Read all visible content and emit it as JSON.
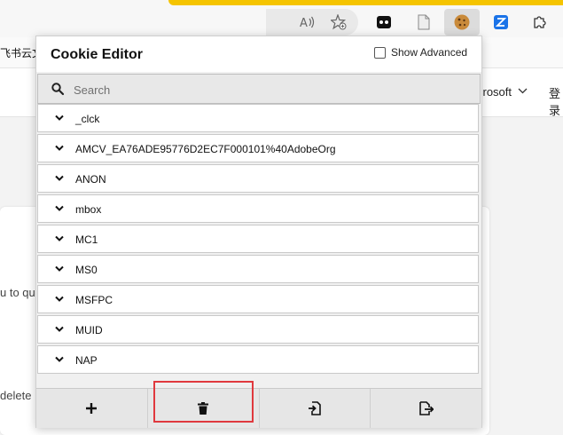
{
  "browser": {
    "favorites_text": "飞书云文",
    "nav_microsoft": "crosoft",
    "nav_login": "登录",
    "icons": [
      "read-aloud-icon",
      "add-favorite-icon",
      "extension-video-icon",
      "document-icon",
      "cookie-extension-icon",
      "extension-z-icon",
      "extensions-puzzle-icon"
    ]
  },
  "background_page": {
    "text_line_1": "u to qu",
    "text_line_2": "delete"
  },
  "popup": {
    "title": "Cookie Editor",
    "show_advanced_label": "Show Advanced",
    "show_advanced_checked": false,
    "search": {
      "placeholder": "Search",
      "value": ""
    },
    "cookies": [
      {
        "name": "_clck"
      },
      {
        "name": "AMCV_EA76ADE95776D2EC7F000101%40AdobeOrg"
      },
      {
        "name": "ANON"
      },
      {
        "name": "mbox"
      },
      {
        "name": "MC1"
      },
      {
        "name": "MS0"
      },
      {
        "name": "MSFPC"
      },
      {
        "name": "MUID"
      },
      {
        "name": "NAP"
      }
    ],
    "toolbar": [
      {
        "id": "add",
        "icon": "plus-icon"
      },
      {
        "id": "delete-all",
        "icon": "trash-icon",
        "highlighted": true
      },
      {
        "id": "import",
        "icon": "import-icon"
      },
      {
        "id": "export",
        "icon": "export-icon"
      }
    ],
    "colors": {
      "highlight": "#e0393e",
      "background": "#f0f0f0"
    }
  }
}
